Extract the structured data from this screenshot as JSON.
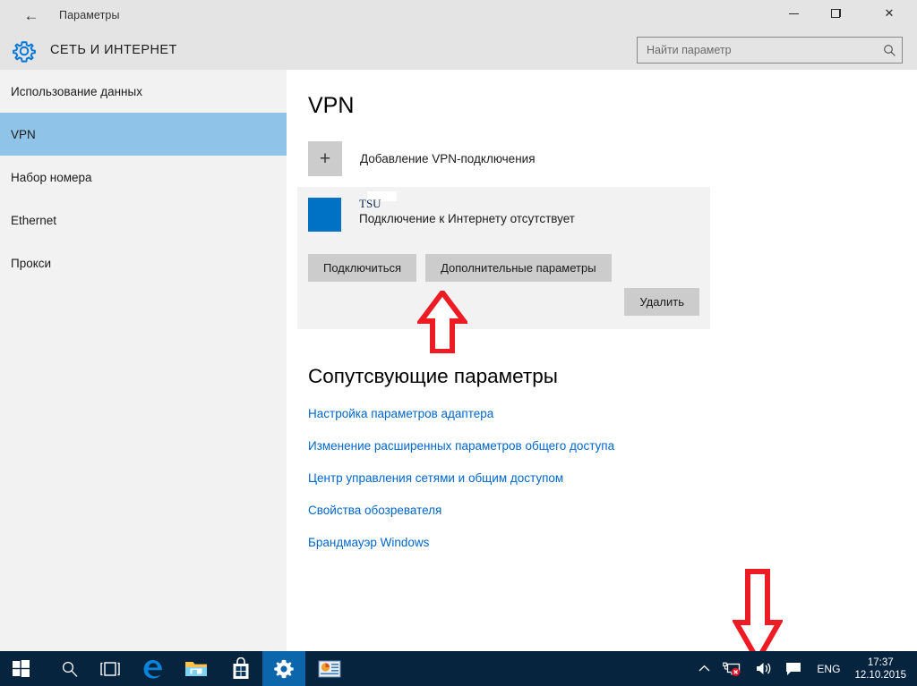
{
  "window": {
    "title": "Параметры",
    "back_icon": "back-arrow-icon",
    "minimize_label": "",
    "maximize_label": "",
    "close_label": "✕"
  },
  "header": {
    "category": "СЕТЬ И ИНТЕРНЕТ",
    "gear_icon": "gear-icon"
  },
  "search": {
    "placeholder": "Найти параметр",
    "value": "",
    "icon": "search-icon"
  },
  "sidebar": {
    "items": [
      {
        "label": "Использование данных",
        "selected": false
      },
      {
        "label": "VPN",
        "selected": true
      },
      {
        "label": "Набор номера",
        "selected": false
      },
      {
        "label": "Ethernet",
        "selected": false
      },
      {
        "label": "Прокси",
        "selected": false
      }
    ]
  },
  "main": {
    "page_title": "VPN",
    "add_vpn": {
      "icon": "plus-icon",
      "plus_glyph": "+",
      "label": "Добавление VPN-подключения"
    },
    "vpn_entry": {
      "name": "TSU",
      "status": "Подключение к Интернету отсутствует",
      "tile_color": "#0072c6",
      "buttons": {
        "connect": "Подключиться",
        "advanced": "Дополнительные параметры",
        "remove": "Удалить"
      }
    },
    "related": {
      "title": "Сопутсвующие параметры",
      "links": [
        "Настройка параметров адаптера",
        "Изменение расширенных параметров общего доступа",
        "Центр управления сетями и общим доступом",
        "Свойства обозревателя",
        "Брандмауэр Windows"
      ]
    }
  },
  "annotations": [
    {
      "name": "arrow-up-annotation",
      "points_to": "Подключиться",
      "color": "#ED1C24"
    },
    {
      "name": "arrow-down-annotation",
      "points_to": "network-tray-icon",
      "color": "#ED1C24"
    }
  ],
  "taskbar": {
    "items": [
      {
        "name": "start-button",
        "icon": "windows-logo-icon",
        "active": false
      },
      {
        "name": "search-button",
        "icon": "search-icon",
        "active": false
      },
      {
        "name": "task-view-button",
        "icon": "task-view-icon",
        "active": false
      },
      {
        "name": "edge-button",
        "icon": "edge-icon",
        "active": false
      },
      {
        "name": "file-explorer-button",
        "icon": "folder-icon",
        "active": false
      },
      {
        "name": "store-button",
        "icon": "store-bag-icon",
        "active": false
      },
      {
        "name": "settings-button",
        "icon": "gear-icon",
        "active": true
      },
      {
        "name": "presentation-button",
        "icon": "presentation-icon",
        "active": false
      }
    ],
    "tray": {
      "overflow_icon": "chevron-up-icon",
      "network_icon": "network-error-icon",
      "volume_icon": "speaker-icon",
      "action_center_icon": "action-center-icon",
      "language": "ENG",
      "time": "17:37",
      "date": "12.10.2015"
    }
  },
  "colors": {
    "accent_blue": "#0078d7",
    "selection_blue": "#8fc3e8",
    "link_blue": "#0066cc",
    "button_gray": "#cccccc",
    "card_gray": "#f2f2f2",
    "chrome_gray": "#e4e4e4",
    "taskbar_navy": "#07243f",
    "annotation_red": "#ED1C24"
  }
}
